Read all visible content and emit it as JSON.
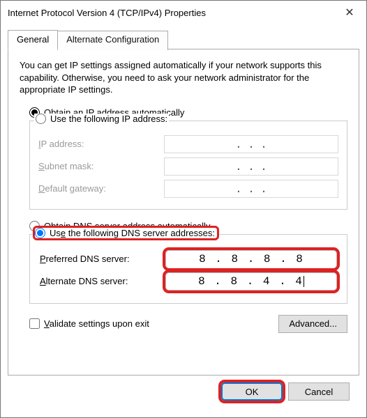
{
  "window": {
    "title": "Internet Protocol Version 4 (TCP/IPv4) Properties"
  },
  "tabs": {
    "general": "General",
    "alternate": "Alternate Configuration"
  },
  "intro": "You can get IP settings assigned automatically if your network supports this capability. Otherwise, you need to ask your network administrator for the appropriate IP settings.",
  "ip": {
    "auto_label_pre": "O",
    "auto_label_rest": "btain an IP address automatically",
    "manual_label_pre": "Use the following IP address:",
    "address_label_pre": "I",
    "address_label_rest": "P address:",
    "subnet_label_pre": "S",
    "subnet_label_rest": "ubnet mask:",
    "gateway_label_pre": "D",
    "gateway_label_rest": "efault gateway:",
    "dots": ".       .       ."
  },
  "dns": {
    "auto_label_pre": "O",
    "auto_label_rest": "btain DNS server address automatically",
    "manual_label_pre": "Us",
    "manual_label_und": "e",
    "manual_label_rest": " the following DNS server addresses:",
    "preferred_label_pre": "P",
    "preferred_label_rest": "referred DNS server:",
    "alternate_label_pre": "A",
    "alternate_label_rest": "lternate DNS server:",
    "preferred_value": "8 . 8 . 8 . 8",
    "alternate_value": "8 . 8 . 4 . 4"
  },
  "validate": {
    "label_pre": "V",
    "label_rest": "alidate settings upon exit"
  },
  "buttons": {
    "advanced": "Advanced...",
    "ok": "OK",
    "cancel": "Cancel"
  }
}
